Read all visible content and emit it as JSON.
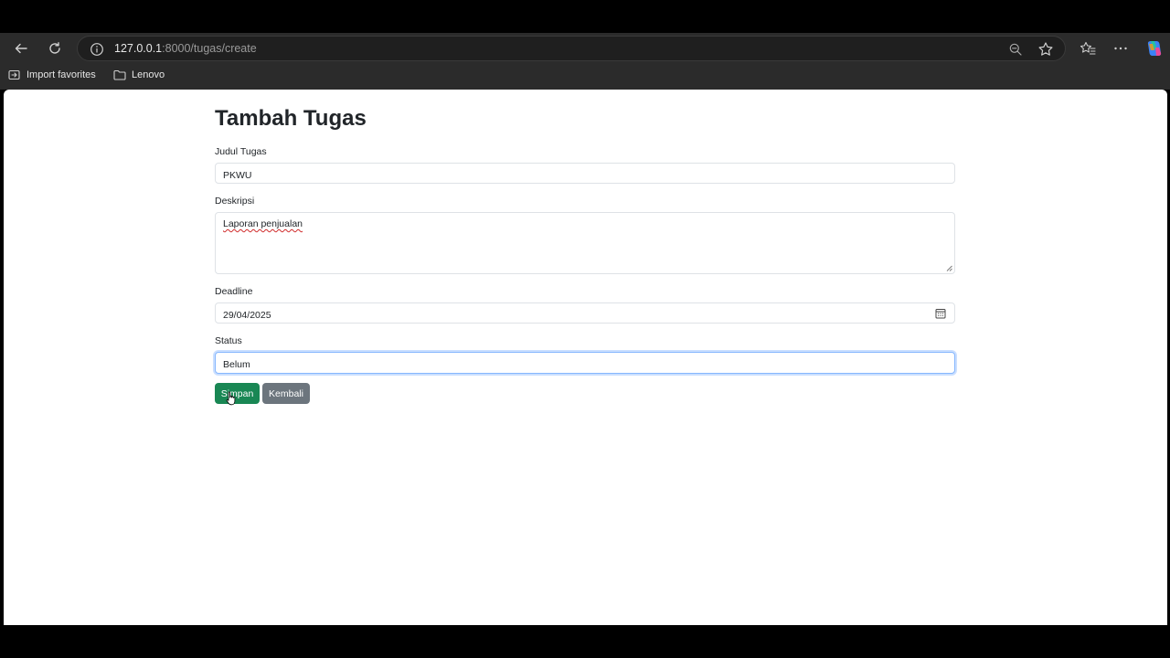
{
  "browser": {
    "url_host": "127.0.0.1",
    "url_path": ":8000/tugas/create",
    "bookmarks": [
      {
        "label": "Import favorites",
        "icon": "import-icon"
      },
      {
        "label": "Lenovo",
        "icon": "folder-icon"
      }
    ]
  },
  "page": {
    "title": "Tambah Tugas",
    "fields": {
      "judul": {
        "label": "Judul Tugas",
        "value": "PKWU"
      },
      "deskripsi": {
        "label": "Deskripsi",
        "value": "Laporan penjualan"
      },
      "deadline": {
        "label": "Deadline",
        "value": "29/04/2025"
      },
      "status": {
        "label": "Status",
        "value": "Belum"
      }
    },
    "buttons": {
      "save": "Simpan",
      "back": "Kembali"
    }
  },
  "colors": {
    "save_button": "#198754",
    "back_button": "#6c757d",
    "focus_border": "#86b7fe"
  }
}
